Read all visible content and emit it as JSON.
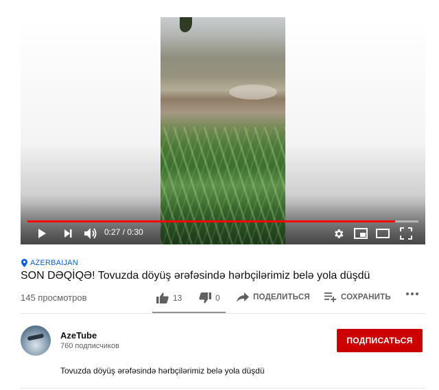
{
  "player": {
    "time_display": "0:27 / 0:30",
    "progress_fraction": 0.94,
    "accent_color": "#ff0000",
    "icons": [
      "play-icon",
      "next-icon",
      "volume-icon",
      "settings-icon",
      "miniplayer-icon",
      "theater-icon",
      "fullscreen-icon"
    ]
  },
  "video": {
    "location": "AZERBAIJAN",
    "title": "SON DƏQİQƏ! Tovuzda döyüş ərəfəsində hərbçilərimiz belə yola düşdü",
    "views": "145 просмотров"
  },
  "actions": {
    "likes": "13",
    "dislikes": "0",
    "share_label": "ПОДЕЛИТЬСЯ",
    "save_label": "СОХРАНИТЬ"
  },
  "channel": {
    "name": "AzeTube",
    "subscribers": "760 подписчиков",
    "subscribe_label": "ПОДПИСАТЬСЯ",
    "subscribe_color": "#cc0000"
  },
  "description": {
    "text": "Tovuzda döyüş ərəfəsində hərbçilərimiz belə yola düşdü"
  }
}
